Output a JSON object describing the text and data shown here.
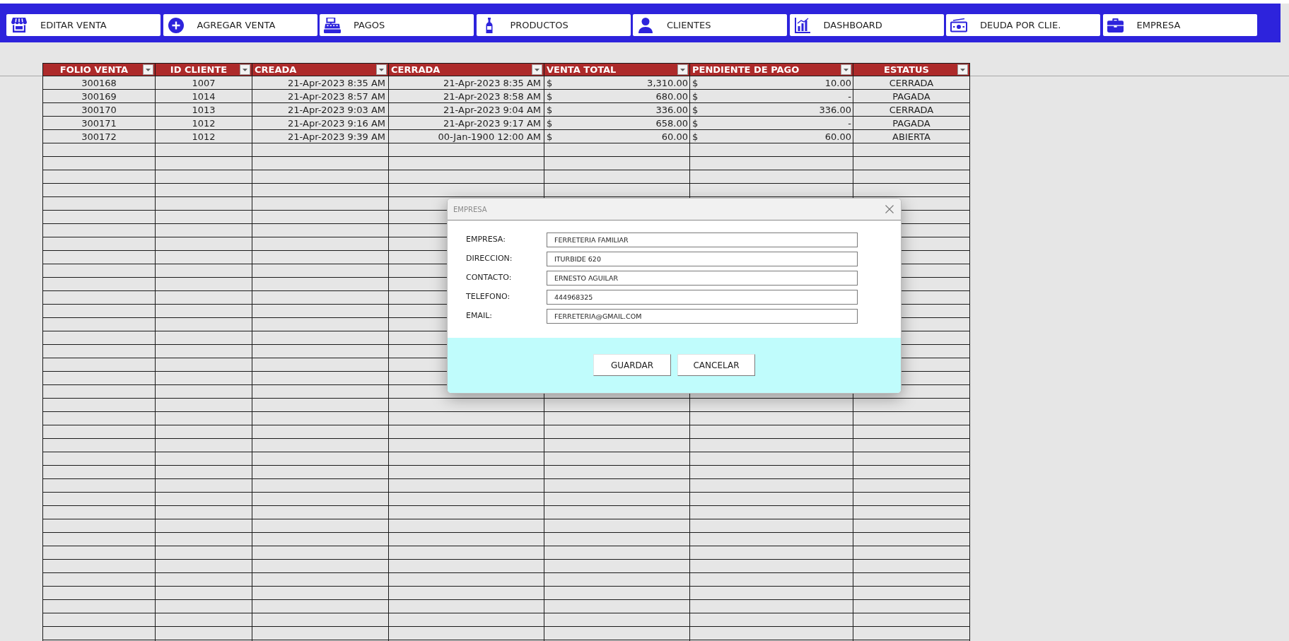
{
  "toolbar": [
    {
      "label": "EDITAR VENTA"
    },
    {
      "label": "AGREGAR VENTA"
    },
    {
      "label": "PAGOS"
    },
    {
      "label": "PRODUCTOS"
    },
    {
      "label": "CLIENTES"
    },
    {
      "label": "DASHBOARD"
    },
    {
      "label": "DEUDA POR CLIE."
    },
    {
      "label": "EMPRESA"
    }
  ],
  "table": {
    "columns": [
      {
        "label": "FOLIO VENTA"
      },
      {
        "label": "ID CLIENTE"
      },
      {
        "label": "CREADA"
      },
      {
        "label": "CERRADA"
      },
      {
        "label": "VENTA TOTAL"
      },
      {
        "label": "PENDIENTE DE PAGO"
      },
      {
        "label": "ESTATUS"
      }
    ],
    "rows": [
      {
        "cells": [
          "300168",
          "1007",
          "21-Apr-2023 8:35 AM",
          "21-Apr-2023 8:35 AM",
          {
            "currency": "$",
            "amount": "3,310.00"
          },
          {
            "currency": "$",
            "amount": "10.00"
          },
          "CERRADA"
        ]
      },
      {
        "cells": [
          "300169",
          "1014",
          "21-Apr-2023 8:57 AM",
          "21-Apr-2023 8:58 AM",
          {
            "currency": "$",
            "amount": "680.00"
          },
          {
            "currency": "$",
            "amount": "-"
          },
          "PAGADA"
        ]
      },
      {
        "cells": [
          "300170",
          "1013",
          "21-Apr-2023 9:03 AM",
          "21-Apr-2023 9:04 AM",
          {
            "currency": "$",
            "amount": "336.00"
          },
          {
            "currency": "$",
            "amount": "336.00"
          },
          "CERRADA"
        ]
      },
      {
        "cells": [
          "300171",
          "1012",
          "21-Apr-2023 9:16 AM",
          "21-Apr-2023 9:17 AM",
          {
            "currency": "$",
            "amount": "658.00"
          },
          {
            "currency": "$",
            "amount": "-"
          },
          "PAGADA"
        ]
      },
      {
        "cells": [
          "300172",
          "1012",
          "21-Apr-2023 9:39 AM",
          "00-Jan-1900 12:00 AM",
          {
            "currency": "$",
            "amount": "60.00"
          },
          {
            "currency": "$",
            "amount": "60.00"
          },
          "ABIERTA"
        ]
      }
    ]
  },
  "dialog": {
    "title": "EMPRESA",
    "fields": [
      {
        "label": "EMPRESA:",
        "value": "FERRETERIA FAMILIAR"
      },
      {
        "label": "DIRECCION:",
        "value": "ITURBIDE 620"
      },
      {
        "label": "CONTACTO:",
        "value": "ERNESTO AGUILAR"
      },
      {
        "label": "TELEFONO:",
        "value": "444968325"
      },
      {
        "label": "EMAIL:",
        "value": "FERRETERIA@GMAIL.COM"
      }
    ],
    "buttons": [
      {
        "label": "GUARDAR"
      },
      {
        "label": "CANCELAR"
      }
    ]
  }
}
